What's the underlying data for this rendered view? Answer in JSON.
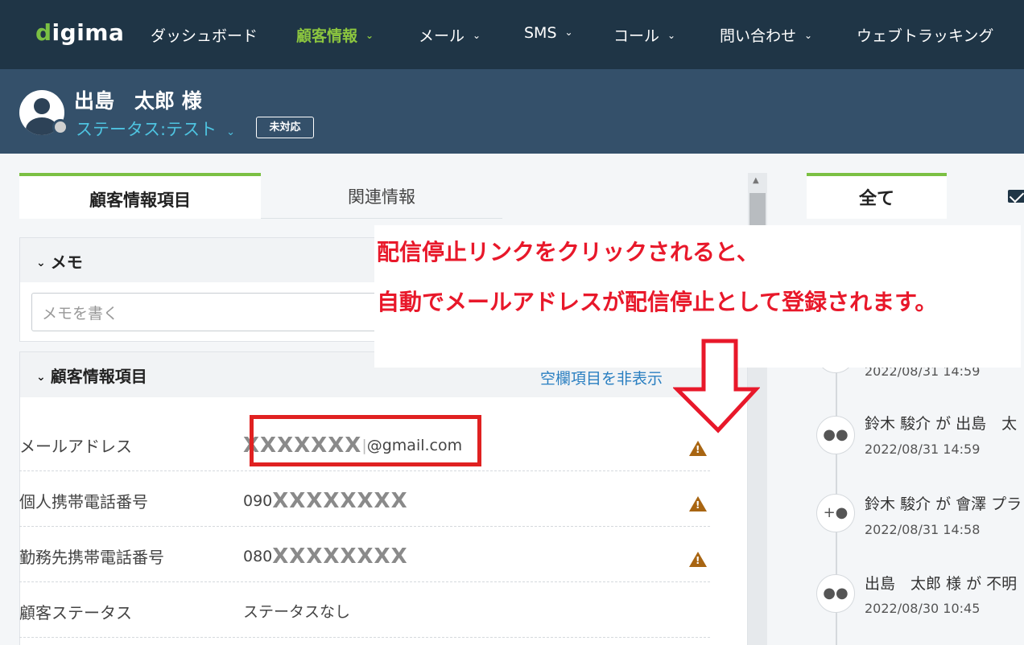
{
  "logo": {
    "brand": "digima",
    "accent_color": "#7bc043"
  },
  "nav": {
    "items": [
      {
        "label": "ダッシュボード",
        "has_dropdown": false,
        "active": false
      },
      {
        "label": "顧客情報",
        "has_dropdown": true,
        "active": true
      },
      {
        "label": "メール",
        "has_dropdown": true,
        "active": false
      },
      {
        "label": "SMS",
        "has_dropdown": true,
        "active": false
      },
      {
        "label": "コール",
        "has_dropdown": true,
        "active": false
      },
      {
        "label": "問い合わせ",
        "has_dropdown": true,
        "active": false
      },
      {
        "label": "ウェブトラッキング",
        "has_dropdown": false,
        "active": false
      }
    ]
  },
  "customer": {
    "name": "出島　太郎 様",
    "status_label": "ステータス:テスト",
    "badge": "未対応"
  },
  "left_tabs": {
    "active": "顧客情報項目",
    "inactive": "関連情報"
  },
  "memo": {
    "title": "メモ",
    "placeholder": "メモを書く"
  },
  "info": {
    "title": "顧客情報項目",
    "hide_empty_link": "空欄項目を非表示",
    "rows": [
      {
        "label": "メールアドレス",
        "value_prefix": "",
        "value_masked": "XXXXXXX",
        "value_suffix": "@gmail.com",
        "warning": true
      },
      {
        "label": "個人携帯電話番号",
        "value_prefix": "090",
        "value_masked": "XXXXXXXX",
        "value_suffix": "",
        "warning": true
      },
      {
        "label": "勤務先携帯電話番号",
        "value_prefix": "080",
        "value_masked": "XXXXXXXX",
        "value_suffix": "",
        "warning": true
      },
      {
        "label": "顧客ステータス",
        "value_prefix": "ステータスなし",
        "value_masked": "",
        "value_suffix": "",
        "warning": false
      }
    ]
  },
  "right_tabs": {
    "all": "全て",
    "mail_icon": "mail-icon"
  },
  "timeline": [
    {
      "icon": "people-icon",
      "text": "",
      "time": "2022/08/31 14:59"
    },
    {
      "icon": "people-icon",
      "text": "鈴木 駿介 が 出島　太",
      "time": "2022/08/31 14:59"
    },
    {
      "icon": "add-people-icon",
      "text": "鈴木 駿介 が 會澤 プラ",
      "time": "2022/08/31 14:58"
    },
    {
      "icon": "people-icon",
      "text": "出島　太郎 様 が 不明",
      "time": "2022/08/30 10:45"
    }
  ],
  "annotation": {
    "line1": "配信停止リンクをクリックされると、",
    "line2": "自動でメールアドレスが配信停止として登録されます。",
    "color": "#e8182a"
  },
  "colors": {
    "topnav": "#1f3546",
    "header": "#34506a",
    "status_text": "#4ec3e0",
    "warning": "#a86512",
    "highlight_box": "#e02121"
  }
}
